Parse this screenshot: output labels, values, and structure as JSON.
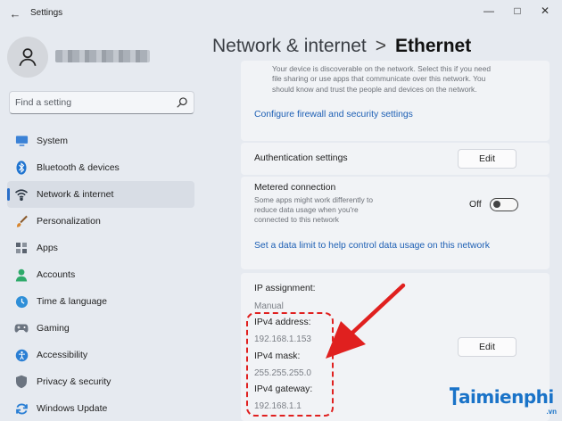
{
  "window": {
    "title": "Settings",
    "back_icon": "arrow-left-icon",
    "controls": [
      "minimize",
      "maximize",
      "close"
    ]
  },
  "sidebar": {
    "search_placeholder": "Find a setting",
    "items": [
      {
        "label": "System",
        "icon": "monitor-icon",
        "color": "#3b82d6"
      },
      {
        "label": "Bluetooth & devices",
        "icon": "bluetooth-icon",
        "color": "#1f74d0"
      },
      {
        "label": "Network & internet",
        "icon": "wifi-icon",
        "color": "#555b63",
        "active": true
      },
      {
        "label": "Personalization",
        "icon": "brush-icon",
        "color": "#d8862e"
      },
      {
        "label": "Apps",
        "icon": "apps-grid-icon",
        "color": "#5b6470"
      },
      {
        "label": "Accounts",
        "icon": "person-icon",
        "color": "#2eaa6a"
      },
      {
        "label": "Time & language",
        "icon": "globe-clock-icon",
        "color": "#2f8fd8"
      },
      {
        "label": "Gaming",
        "icon": "gamepad-icon",
        "color": "#6b7480"
      },
      {
        "label": "Accessibility",
        "icon": "accessibility-icon",
        "color": "#2a7fd4"
      },
      {
        "label": "Privacy & security",
        "icon": "shield-icon",
        "color": "#6b7480"
      },
      {
        "label": "Windows Update",
        "icon": "refresh-icon",
        "color": "#2a7fd4"
      }
    ]
  },
  "breadcrumb": {
    "parent": "Network & internet",
    "separator": ">",
    "current": "Ethernet"
  },
  "discovery": {
    "description_lines": [
      "Your device is discoverable on the network. Select this if you need",
      "file sharing or use apps that communicate over this network. You",
      "should know and trust the people and devices on the network."
    ],
    "firewall_link": "Configure firewall and security settings"
  },
  "authentication": {
    "label": "Authentication settings",
    "button": "Edit"
  },
  "metered": {
    "label": "Metered connection",
    "description_lines": [
      "Some apps might work differently to",
      "reduce data usage when you're",
      "connected to this network"
    ],
    "toggle_state": "Off",
    "data_limit_link": "Set a data limit to help control data usage on this network"
  },
  "ip": {
    "assignment_label": "IP assignment:",
    "assignment_value": "Manual",
    "ipv4_address_label": "IPv4 address:",
    "ipv4_address_value": "192.168.1.153",
    "ipv4_mask_label": "IPv4 mask:",
    "ipv4_mask_value": "255.255.255.0",
    "ipv4_gateway_label": "IPv4 gateway:",
    "ipv4_gateway_value": "192.168.1.1",
    "button": "Edit"
  },
  "watermark": {
    "text": "aimienphi",
    "suffix": ".vn"
  },
  "colors": {
    "accent": "#2a6fc9",
    "link": "#1d5fb4",
    "highlight": "#e0201f"
  }
}
